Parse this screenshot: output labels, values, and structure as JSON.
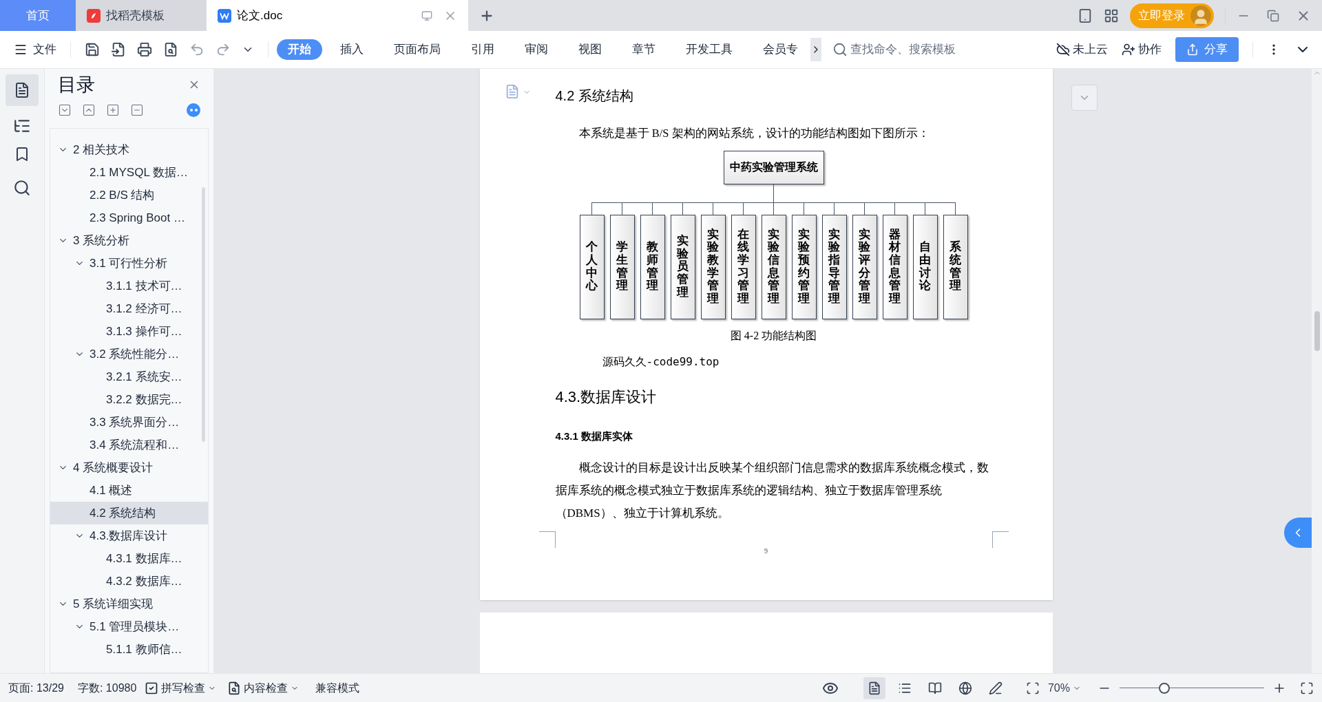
{
  "tabs": [
    {
      "label": "首页",
      "kind": "home",
      "selected": false
    },
    {
      "label": "找稻壳模板",
      "kind": "docer",
      "selected": false
    },
    {
      "label": "论文.doc",
      "kind": "doc",
      "selected": true
    }
  ],
  "account": {
    "login": "立即登录"
  },
  "toolbar": {
    "file": "文件",
    "ribbon_tabs": [
      {
        "label": "开始",
        "selected": true
      },
      {
        "label": "插入",
        "selected": false
      },
      {
        "label": "页面布局",
        "selected": false
      },
      {
        "label": "引用",
        "selected": false
      },
      {
        "label": "审阅",
        "selected": false
      },
      {
        "label": "视图",
        "selected": false
      },
      {
        "label": "章节",
        "selected": false
      },
      {
        "label": "开发工具",
        "selected": false
      },
      {
        "label": "会员专",
        "selected": false
      }
    ],
    "search": {
      "placeholder": "查找命令、搜索模板"
    },
    "cloud": "未上云",
    "collaborate": "协作",
    "share": "分享"
  },
  "toc": {
    "title": "目录",
    "items": [
      {
        "label": "2 相关技术",
        "expanded": true,
        "selected": false,
        "children": [
          {
            "label": "2.1 MYSQL 数据…",
            "selected": false
          },
          {
            "label": "2.2 B/S 结构",
            "selected": false
          },
          {
            "label": "2.3 Spring Boot …",
            "selected": false
          }
        ]
      },
      {
        "label": "3 系统分析",
        "expanded": true,
        "selected": false,
        "children": [
          {
            "label": "3.1 可行性分析",
            "expanded": true,
            "selected": false,
            "children": [
              {
                "label": "3.1.1 技术可…",
                "selected": false
              },
              {
                "label": "3.1.2 经济可…",
                "selected": false
              },
              {
                "label": "3.1.3 操作可…",
                "selected": false
              }
            ]
          },
          {
            "label": "3.2 系统性能分…",
            "expanded": true,
            "selected": false,
            "children": [
              {
                "label": "3.2.1  系统安…",
                "selected": false
              },
              {
                "label": "3.2.2  数据完…",
                "selected": false
              }
            ]
          },
          {
            "label": "3.3 系统界面分…",
            "selected": false
          },
          {
            "label": "3.4 系统流程和…",
            "selected": false
          }
        ]
      },
      {
        "label": "4 系统概要设计",
        "expanded": true,
        "selected": false,
        "children": [
          {
            "label": "4.1 概述",
            "selected": false
          },
          {
            "label": "4.2 系统结构",
            "selected": true
          },
          {
            "label": "4.3.数据库设计",
            "expanded": true,
            "selected": false,
            "children": [
              {
                "label": "4.3.1 数据库…",
                "selected": false
              },
              {
                "label": "4.3.2 数据库…",
                "selected": false
              }
            ]
          }
        ]
      },
      {
        "label": "5 系统详细实现",
        "expanded": true,
        "selected": false,
        "children": [
          {
            "label": "5.1  管理员模块…",
            "expanded": true,
            "selected": false,
            "children": [
              {
                "label": "5.1.1  教师信…",
                "selected": false
              }
            ]
          }
        ]
      }
    ]
  },
  "document": {
    "heading": "4.2 系统结构",
    "intro": "本系统是基于 B/S 架构的网站系统，设计的功能结构图如下图所示：",
    "diagram": {
      "root": "中药实验管理系统",
      "children": [
        "个人中心",
        "学生管理",
        "教师管理",
        "实验员管理",
        "实验教学管理",
        "在线学习管理",
        "实验信息管理",
        "实验预约管理",
        "实验指导管理",
        "实验评分管理",
        "器材信息管理",
        "自由讨论",
        "系统管理"
      ]
    },
    "caption": "图 4-2 功能结构图",
    "source_note": "源码久久-code99.top",
    "heading2": "4.3.数据库设计",
    "heading3": "4.3.1 数据库实体",
    "paragraph": "概念设计的目标是设计出反映某个组织部门信息需求的数据库系统概念模式，数据库系统的概念模式独立于数据库系统的逻辑结构、独立于数据库管理系统（DBMS）、独立于计算机系统。",
    "page_number": "9"
  },
  "status_bar": {
    "page": "页面: 13/29",
    "words": "字数: 10980",
    "spell_check": "拼写检查",
    "content_check": "内容检查",
    "compat": "兼容模式",
    "view_modes": [
      {
        "kind": "page",
        "selected": true
      },
      {
        "kind": "outline",
        "selected": false
      },
      {
        "kind": "reading",
        "selected": false
      },
      {
        "kind": "web",
        "selected": false
      },
      {
        "kind": "write",
        "selected": false
      }
    ],
    "zoom": "70%",
    "zoom_slider": {
      "level": 0.31
    }
  }
}
